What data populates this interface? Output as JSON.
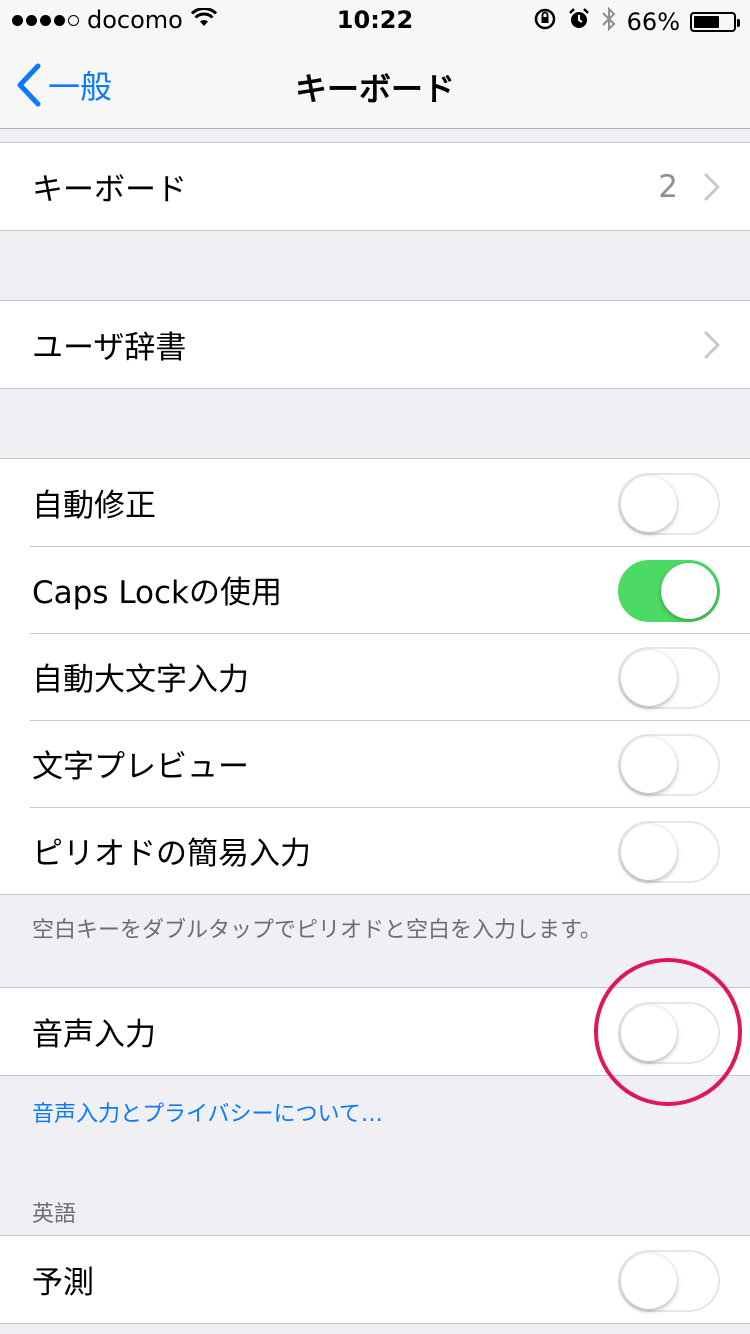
{
  "status_bar": {
    "carrier": "docomo",
    "signal_dots": 5,
    "signal_filled": 4,
    "time": "10:22",
    "battery_text": "66%",
    "battery_level": 0.66
  },
  "nav": {
    "back_label": "一般",
    "title": "キーボード"
  },
  "keyboards_row": {
    "label": "キーボード",
    "value": "2"
  },
  "user_dict_row": {
    "label": "ユーザ辞書"
  },
  "settings": [
    {
      "label": "自動修正",
      "on": false
    },
    {
      "label": "Caps Lockの使用",
      "on": true
    },
    {
      "label": "自動大文字入力",
      "on": false
    },
    {
      "label": "文字プレビュー",
      "on": false
    },
    {
      "label": "ピリオドの簡易入力",
      "on": false
    }
  ],
  "period_note": "空白キーをダブルタップでピリオドと空白を入力します。",
  "dictation": {
    "label": "音声入力",
    "on": false
  },
  "dictation_link": "音声入力とプライバシーについて…",
  "english_header": "英語",
  "prediction": {
    "label": "予測",
    "on": false
  },
  "colors": {
    "accent": "#0a7aff",
    "toggle_on": "#4cd964",
    "highlight_circle": "#e0155c",
    "background": "#efeff4"
  }
}
